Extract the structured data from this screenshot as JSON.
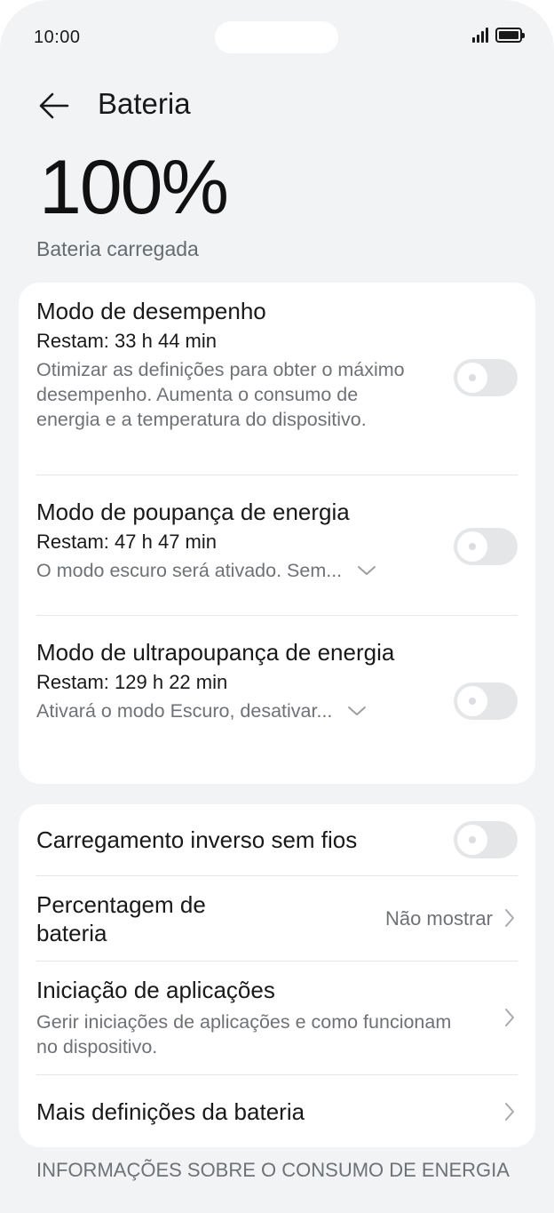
{
  "status_bar": {
    "time": "10:00"
  },
  "header": {
    "title": "Bateria"
  },
  "battery": {
    "percent": "100%",
    "status": "Bateria carregada"
  },
  "modes": [
    {
      "title": "Modo de desempenho",
      "remaining": "Restam: 33 h 44 min",
      "description": "Otimizar as definições para obter o máximo desempenho. Aumenta o consumo de energia e a temperatura do dispositivo.",
      "enabled": false
    },
    {
      "title": "Modo de poupança de energia",
      "remaining": "Restam: 47 h 47 min",
      "description": "O modo escuro será ativado. Sem...",
      "enabled": false
    },
    {
      "title": "Modo de ultrapoupança de energia",
      "remaining": "Restam: 129 h 22 min",
      "description": "Ativará o modo Escuro, desativar...",
      "enabled": false
    }
  ],
  "settings": {
    "reverse_charging": {
      "label": "Carregamento inverso sem fios",
      "enabled": false
    },
    "battery_percentage": {
      "label": "Percentagem de bateria",
      "value": "Não mostrar"
    },
    "app_launch": {
      "label": "Iniciação de aplicações",
      "description": "Gerir iniciações de aplicações e como funcionam no dispositivo."
    },
    "more_settings": {
      "label": "Mais definições da bateria"
    }
  },
  "section_header": "INFORMAÇÕES SOBRE O CONSUMO DE ENERGIA",
  "colors": {
    "background": "#f1f3f5",
    "card": "#ffffff",
    "toggle_off": "#e5e6e8",
    "secondary_text": "#6e7276"
  }
}
